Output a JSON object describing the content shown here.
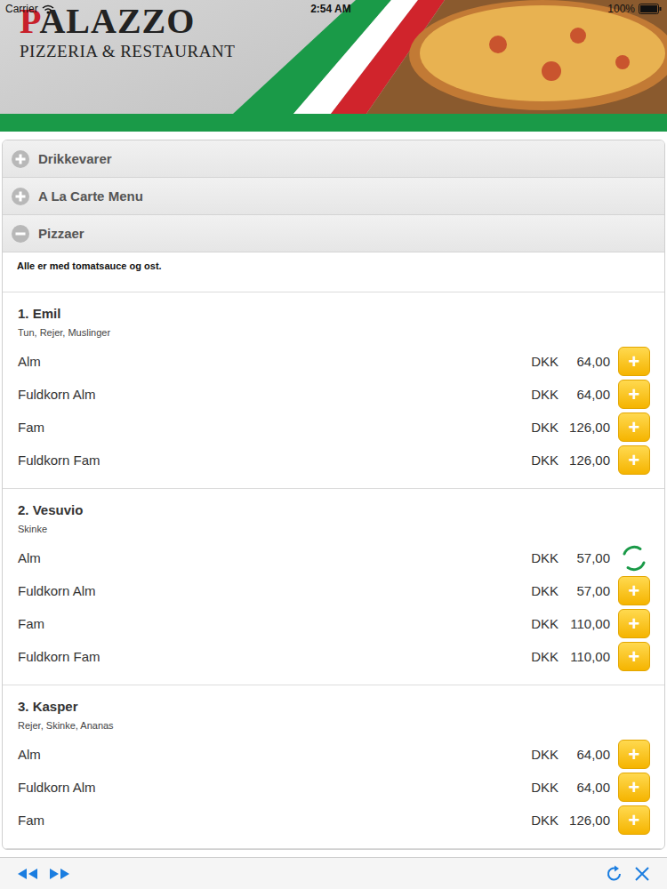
{
  "status_bar": {
    "carrier": "Carrier",
    "time": "2:54 AM",
    "battery": "100%"
  },
  "header": {
    "logo": "PALAZZO",
    "subtitle": "PIZZERIA & RESTAURANT"
  },
  "add_label": "+",
  "sections": [
    {
      "title": "Drikkevarer",
      "expanded": false
    },
    {
      "title": "A La Carte Menu",
      "expanded": false
    },
    {
      "title": "Pizzaer",
      "expanded": true,
      "note": "Alle er med tomatsauce og ost.",
      "items": [
        {
          "name": "1. Emil",
          "ingredients": "Tun, Rejer, Muslinger",
          "options": [
            {
              "label": "Alm",
              "currency": "DKK",
              "price": "64,00",
              "loading": false
            },
            {
              "label": "Fuldkorn Alm",
              "currency": "DKK",
              "price": "64,00",
              "loading": false
            },
            {
              "label": "Fam",
              "currency": "DKK",
              "price": "126,00",
              "loading": false
            },
            {
              "label": "Fuldkorn Fam",
              "currency": "DKK",
              "price": "126,00",
              "loading": false
            }
          ]
        },
        {
          "name": "2. Vesuvio",
          "ingredients": "Skinke",
          "options": [
            {
              "label": "Alm",
              "currency": "DKK",
              "price": "57,00",
              "loading": true
            },
            {
              "label": "Fuldkorn Alm",
              "currency": "DKK",
              "price": "57,00",
              "loading": false
            },
            {
              "label": "Fam",
              "currency": "DKK",
              "price": "110,00",
              "loading": false
            },
            {
              "label": "Fuldkorn Fam",
              "currency": "DKK",
              "price": "110,00",
              "loading": false
            }
          ]
        },
        {
          "name": "3. Kasper",
          "ingredients": "Rejer, Skinke, Ananas",
          "options": [
            {
              "label": "Alm",
              "currency": "DKK",
              "price": "64,00",
              "loading": false
            },
            {
              "label": "Fuldkorn Alm",
              "currency": "DKK",
              "price": "64,00",
              "loading": false
            },
            {
              "label": "Fam",
              "currency": "DKK",
              "price": "126,00",
              "loading": false
            }
          ]
        }
      ]
    }
  ]
}
